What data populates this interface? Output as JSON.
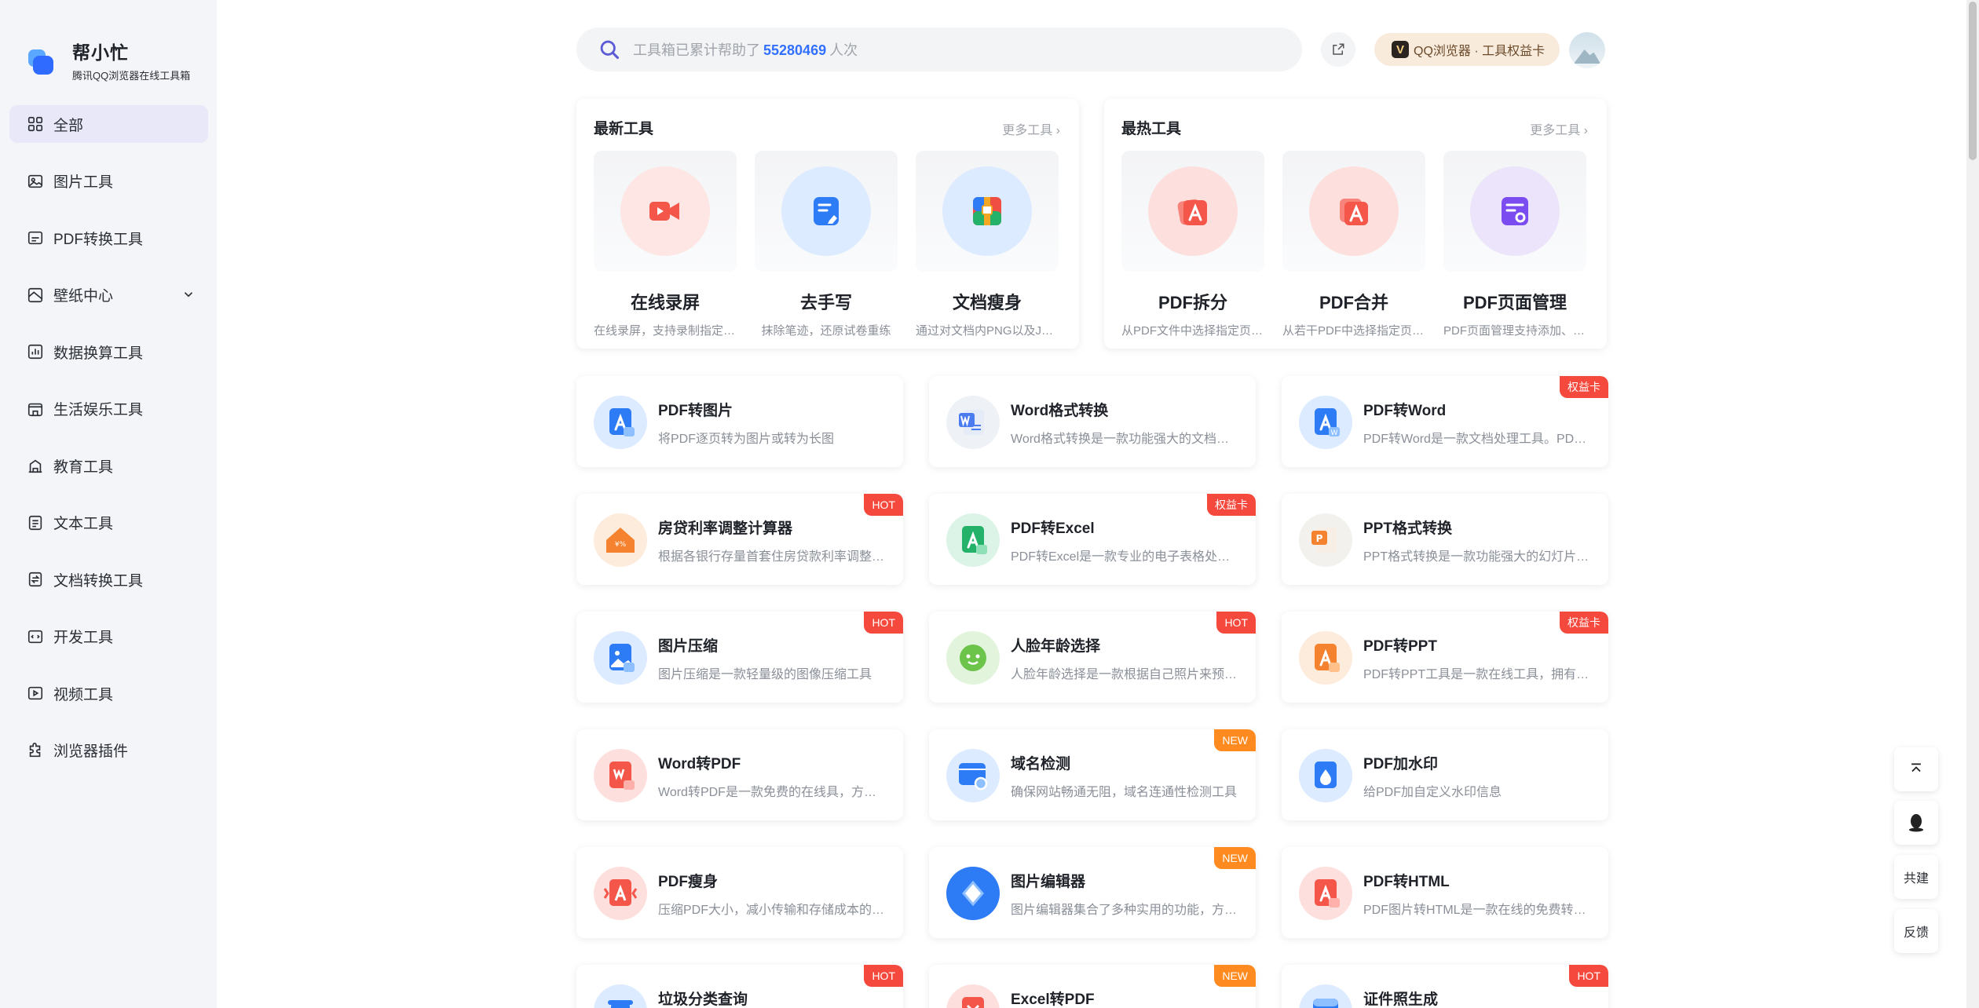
{
  "brand": {
    "title": "帮小忙",
    "subtitle": "腾讯QQ浏览器在线工具箱"
  },
  "nav": [
    {
      "label": "全部",
      "icon": "grid-icon",
      "active": true
    },
    {
      "label": "图片工具",
      "icon": "image-icon"
    },
    {
      "label": "PDF转换工具",
      "icon": "pdf-icon"
    },
    {
      "label": "壁纸中心",
      "icon": "wallpaper-icon",
      "expandable": true
    },
    {
      "label": "数据换算工具",
      "icon": "chart-icon"
    },
    {
      "label": "生活娱乐工具",
      "icon": "shop-icon"
    },
    {
      "label": "教育工具",
      "icon": "school-icon"
    },
    {
      "label": "文本工具",
      "icon": "document-icon"
    },
    {
      "label": "文档转换工具",
      "icon": "convert-icon"
    },
    {
      "label": "开发工具",
      "icon": "code-icon"
    },
    {
      "label": "视频工具",
      "icon": "video-icon"
    },
    {
      "label": "浏览器插件",
      "icon": "plugin-icon"
    }
  ],
  "search": {
    "prefix": "工具箱已累计帮助了",
    "count": "55280469",
    "suffix": "人次"
  },
  "qq_card": {
    "v": "V",
    "label": "QQ浏览器 · 工具权益卡"
  },
  "latest": {
    "title": "最新工具",
    "more": "更多工具",
    "items": [
      {
        "name": "在线录屏",
        "desc": "在线录屏，支持录制指定窗口...",
        "icon": "record-icon",
        "bg": "#fde6e3",
        "color": "#f5564a"
      },
      {
        "name": "去手写",
        "desc": "抹除笔迹，还原试卷重练",
        "icon": "eraser-icon",
        "bg": "#dcebff",
        "color": "#2e7bf6"
      },
      {
        "name": "文档瘦身",
        "desc": "通过对文档内PNG以及JPG图片...",
        "icon": "compress-icon",
        "bg": "#dcebff",
        "color": "#2e7bf6"
      }
    ]
  },
  "hot": {
    "title": "最热工具",
    "more": "更多工具",
    "items": [
      {
        "name": "PDF拆分",
        "desc": "从PDF文件中选择指定页面...",
        "icon": "pdf-split-icon",
        "bg": "#fde0de",
        "color": "#f5564a"
      },
      {
        "name": "PDF合并",
        "desc": "从若干PDF中选择指定页面...",
        "icon": "pdf-merge-icon",
        "bg": "#fde0de",
        "color": "#f5564a"
      },
      {
        "name": "PDF页面管理",
        "desc": "PDF页面管理支持添加、删除...",
        "icon": "pdf-manage-icon",
        "bg": "#ece4fb",
        "color": "#7b4cf0"
      }
    ]
  },
  "tools": [
    {
      "name": "PDF转图片",
      "desc": "将PDF逐页转为图片或转为长图",
      "icon": "pdf-to-image-icon",
      "bg": "#dcebff",
      "color": "#2e7bf6",
      "badge": ""
    },
    {
      "name": "Word格式转换",
      "desc": "Word格式转换是一款功能强大的文档转换工具",
      "icon": "word-icon",
      "bg": "#eef1f6",
      "color": "#4a7cf0",
      "badge": ""
    },
    {
      "name": "PDF转Word",
      "desc": "PDF转Word是一款文档处理工具。PDF转Word",
      "icon": "pdf-to-word-icon",
      "bg": "#dcebff",
      "color": "#2e7bf6",
      "badge": "权益卡",
      "badge_type": "right"
    },
    {
      "name": "房贷利率调整计算器",
      "desc": "根据各银行存量首套住房贷款利率调整计算",
      "icon": "house-icon",
      "bg": "#fdebdc",
      "color": "#f5822e",
      "badge": "HOT",
      "badge_type": "hot"
    },
    {
      "name": "PDF转Excel",
      "desc": "PDF转Excel是一款专业的电子表格处理工具",
      "icon": "pdf-to-excel-icon",
      "bg": "#dcf4e8",
      "color": "#24b26a",
      "badge": "权益卡",
      "badge_type": "right"
    },
    {
      "name": "PPT格式转换",
      "desc": "PPT格式转换是一款功能强大的幻灯片转换工具",
      "icon": "ppt-icon",
      "bg": "#f3f1ee",
      "color": "#f5822e",
      "badge": ""
    },
    {
      "name": "图片压缩",
      "desc": "图片压缩是一款轻量级的图像压缩工具",
      "icon": "image-compress-icon",
      "bg": "#dcebff",
      "color": "#2e7bf6",
      "badge": "HOT",
      "badge_type": "hot"
    },
    {
      "name": "人脸年龄选择",
      "desc": "人脸年龄选择是一款根据自己照片来预测年龄的工具",
      "icon": "face-icon",
      "bg": "#e2f5dc",
      "color": "#6cc44b",
      "badge": "HOT",
      "badge_type": "hot"
    },
    {
      "name": "PDF转PPT",
      "desc": "PDF转PPT工具是一款在线工具，拥有强大的功能",
      "icon": "pdf-to-ppt-icon",
      "bg": "#fdebdc",
      "color": "#f5822e",
      "badge": "权益卡",
      "badge_type": "right"
    },
    {
      "name": "Word转PDF",
      "desc": "Word转PDF是一款免费的在线具，方便快捷",
      "icon": "word-to-pdf-icon",
      "bg": "#fde0de",
      "color": "#f5564a",
      "badge": ""
    },
    {
      "name": "域名检测",
      "desc": "确保网站畅通无阻，域名连通性检测工具",
      "icon": "domain-icon",
      "bg": "#dcebff",
      "color": "#2e7bf6",
      "badge": "NEW",
      "badge_type": "new"
    },
    {
      "name": "PDF加水印",
      "desc": "给PDF加自定义水印信息",
      "icon": "watermark-icon",
      "bg": "#dcebff",
      "color": "#2e7bf6",
      "badge": ""
    },
    {
      "name": "PDF瘦身",
      "desc": "压缩PDF大小，减小传输和存储成本的工具",
      "icon": "pdf-slim-icon",
      "bg": "#fde0de",
      "color": "#f5564a",
      "badge": ""
    },
    {
      "name": "图片编辑器",
      "desc": "图片编辑器集合了多种实用的功能，方便快捷",
      "icon": "image-editor-icon",
      "bg": "#2e7bf6",
      "color": "#ffffff",
      "badge": "NEW",
      "badge_type": "new"
    },
    {
      "name": "PDF转HTML",
      "desc": "PDF图片转HTML是一款在线的免费转换工具",
      "icon": "pdf-to-html-icon",
      "bg": "#fde0de",
      "color": "#f5564a",
      "badge": ""
    },
    {
      "name": "垃圾分类查询",
      "desc": "",
      "icon": "trash-icon",
      "bg": "#dcebff",
      "color": "#2e7bf6",
      "badge": "HOT",
      "badge_type": "hot"
    },
    {
      "name": "Excel转PDF",
      "desc": "",
      "icon": "excel-to-pdf-icon",
      "bg": "#fde0de",
      "color": "#f5564a",
      "badge": "NEW",
      "badge_type": "new"
    },
    {
      "name": "证件照生成",
      "desc": "",
      "icon": "id-photo-icon",
      "bg": "#dcebff",
      "color": "#2e7bf6",
      "badge": "HOT",
      "badge_type": "hot"
    }
  ],
  "float": {
    "build": "共建",
    "feedback": "反馈"
  }
}
